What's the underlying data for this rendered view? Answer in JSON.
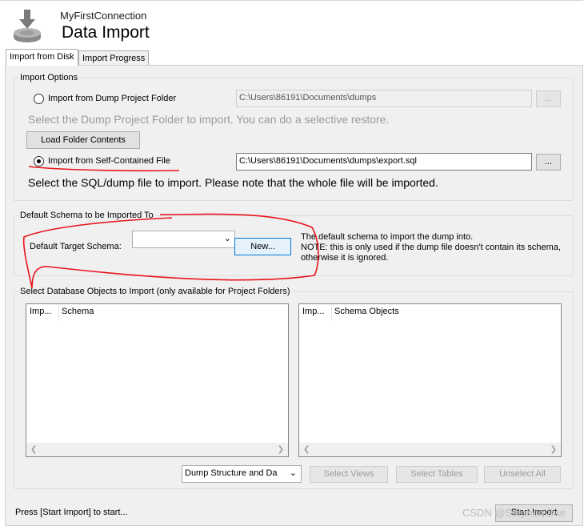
{
  "header": {
    "connection_name": "MyFirstConnection",
    "title": "Data Import",
    "icon": "database-import-icon"
  },
  "tabs": [
    {
      "label": "Import from Disk",
      "active": true
    },
    {
      "label": "Import Progress",
      "active": false
    }
  ],
  "import_options": {
    "group_label": "Import Options",
    "dump_folder": {
      "label": "Import from Dump Project Folder",
      "selected": false,
      "path": "C:\\Users\\86191\\Documents\\dumps",
      "browse_label": "...",
      "hint": "Select the Dump Project Folder to import. You can do a selective restore.",
      "load_button": "Load Folder Contents"
    },
    "self_contained": {
      "label": "Import from Self-Contained File",
      "selected": true,
      "path": "C:\\Users\\86191\\Documents\\dumps\\export.sql",
      "browse_label": "...",
      "hint": "Select the SQL/dump file to import. Please note that the whole file will be imported."
    }
  },
  "default_schema": {
    "group_label": "Default Schema to be Imported To",
    "target_label": "Default Target Schema:",
    "selected_value": "",
    "new_button": "New...",
    "note_line1": "The default schema to import the dump into.",
    "note_line2": "NOTE: this is only used if the dump file doesn't contain its schema,",
    "note_line3": "otherwise it is ignored."
  },
  "objects": {
    "group_label": "Select Database Objects to Import (only available for Project Folders)",
    "left_list": {
      "col1": "Imp...",
      "col2": "Schema"
    },
    "right_list": {
      "col1": "Imp...",
      "col2": "Schema Objects"
    },
    "dump_select_value": "Dump Structure and Da",
    "select_views": "Select Views",
    "select_tables": "Select Tables",
    "unselect_all": "Unselect All"
  },
  "status": {
    "text": "Press [Start Import] to start...",
    "start_button": "Start Import"
  },
  "watermark": "CSDN @Stephen Bae",
  "colors": {
    "panel_bg": "#f0f0f0",
    "annotation_red": "#e8141b",
    "focus_blue": "#0078d7"
  }
}
